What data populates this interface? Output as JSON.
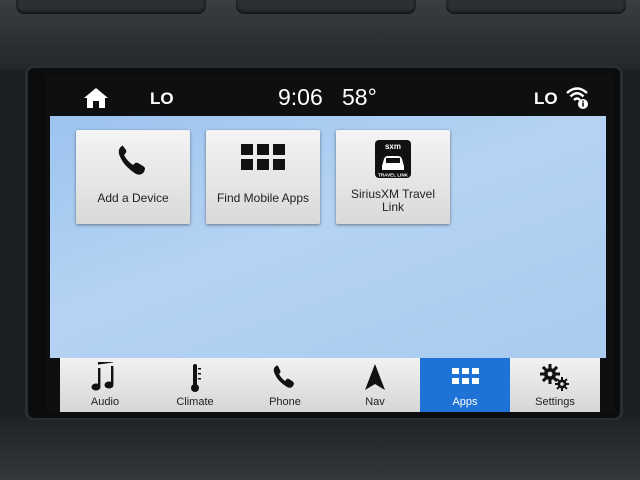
{
  "status_bar": {
    "left_temp": "LO",
    "time": "9:06",
    "outside_temp": "58°",
    "right_temp": "LO"
  },
  "apps": [
    {
      "label": "Add a Device",
      "icon": "phone-handset-icon"
    },
    {
      "label": "Find Mobile Apps",
      "icon": "grid-icon"
    },
    {
      "label": "SiriusXM Travel Link",
      "icon": "siriusxm-travel-link-icon",
      "badge_text": "sxm",
      "badge_subtext": "TRAVEL LINK"
    }
  ],
  "nav": [
    {
      "label": "Audio",
      "icon": "music-note-icon"
    },
    {
      "label": "Climate",
      "icon": "thermometer-icon"
    },
    {
      "label": "Phone",
      "icon": "phone-icon"
    },
    {
      "label": "Nav",
      "icon": "navigation-arrow-icon"
    },
    {
      "label": "Apps",
      "icon": "apps-grid-icon",
      "active": true
    },
    {
      "label": "Settings",
      "icon": "gears-icon"
    }
  ],
  "colors": {
    "active_tab": "#1f73d6",
    "content_background": "#a9cbef"
  }
}
